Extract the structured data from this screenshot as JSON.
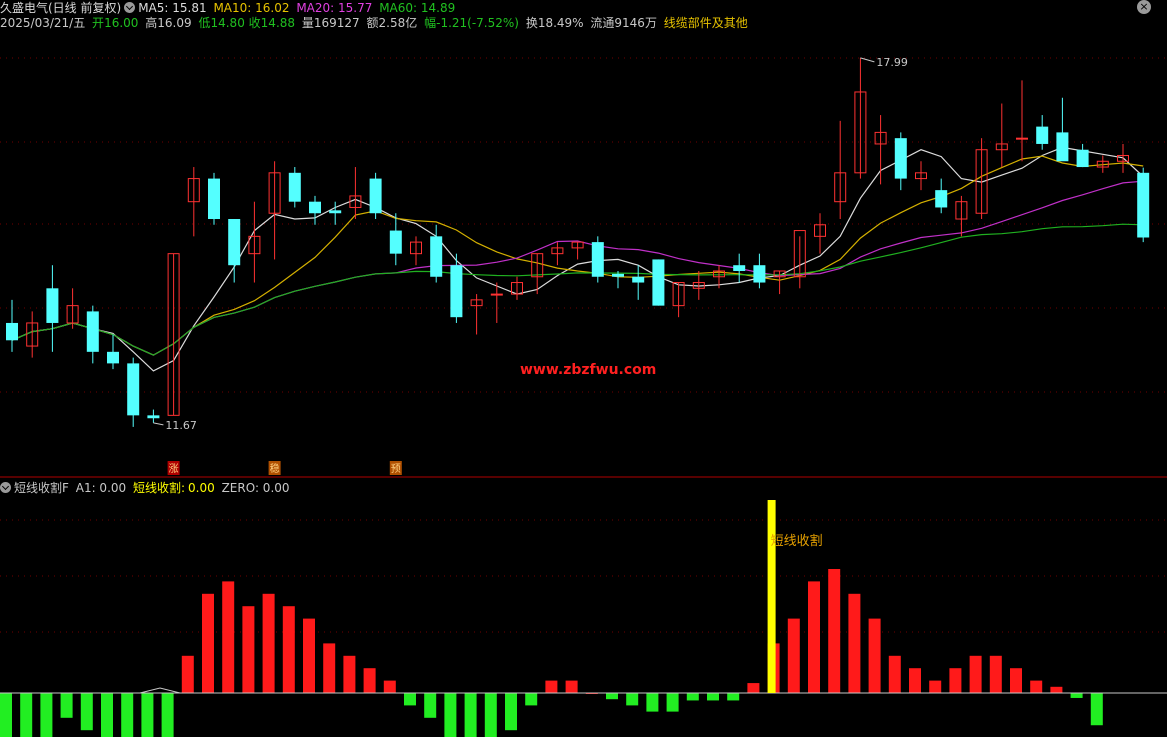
{
  "header": {
    "title": "久盛电气(日线 前复权)",
    "ma": [
      {
        "label": "MA5: 15.81",
        "color": "#dcdcdc"
      },
      {
        "label": "MA10: 16.02",
        "color": "#e6c200"
      },
      {
        "label": "MA20: 15.77",
        "color": "#e040e0"
      },
      {
        "label": "MA60: 14.89",
        "color": "#20c020"
      }
    ],
    "close_icon": "close-icon",
    "expand_icon": "chevron-down-icon"
  },
  "quote": {
    "date": "2025/03/21/五",
    "open_label": "开",
    "open": "16.00",
    "high_label": "高",
    "high": "16.09",
    "low_label": "低",
    "low": "14.80",
    "close_label": "收",
    "close": "14.88",
    "vol_label": "量",
    "vol": "169127",
    "amount_label": "额",
    "amount": "2.58亿",
    "change_label": "幅",
    "change": "-1.21(-7.52%)",
    "turnover": "换18.49%",
    "float": "流通9146万",
    "sector": "线缆部件及其他"
  },
  "price_labels": {
    "high_mark": "17.99",
    "low_mark": "11.67"
  },
  "signals": [
    "涨",
    "稳",
    "预"
  ],
  "watermark": "www.zbzfwu.com",
  "indicator": {
    "name": "短线收割F",
    "a1": "A1: 0.00",
    "cut_label": "短线收割:",
    "cut_value": "0.00",
    "zero": "ZERO: 0.00",
    "annotation": "短线收割"
  },
  "colors": {
    "up": "#ff3232",
    "down": "#54ffff",
    "bar_up": "#ff1a1a",
    "bar_down": "#22ee22",
    "signal": "#ffff00"
  },
  "chart_data": {
    "type": "candlestick",
    "price_range": [
      11.2,
      18.3
    ],
    "candles": [
      [
        13.4,
        13.8,
        12.9,
        13.1
      ],
      [
        13.0,
        13.6,
        12.8,
        13.4
      ],
      [
        14.0,
        14.4,
        12.9,
        13.4
      ],
      [
        13.4,
        14.0,
        13.3,
        13.7
      ],
      [
        13.6,
        13.7,
        12.7,
        12.9
      ],
      [
        12.9,
        13.2,
        12.6,
        12.7
      ],
      [
        12.7,
        12.8,
        11.6,
        11.8
      ],
      [
        11.8,
        11.9,
        11.67,
        11.75
      ],
      [
        11.8,
        14.6,
        11.8,
        14.6
      ],
      [
        15.5,
        16.1,
        14.9,
        15.9
      ],
      [
        15.9,
        16.0,
        15.1,
        15.2
      ],
      [
        15.2,
        15.2,
        14.1,
        14.4
      ],
      [
        14.6,
        15.5,
        14.1,
        14.9
      ],
      [
        15.3,
        16.2,
        14.5,
        16.0
      ],
      [
        16.0,
        16.1,
        15.4,
        15.5
      ],
      [
        15.5,
        15.6,
        15.1,
        15.3
      ],
      [
        15.35,
        15.5,
        15.1,
        15.3
      ],
      [
        15.4,
        16.1,
        15.2,
        15.6
      ],
      [
        15.9,
        16.0,
        15.2,
        15.3
      ],
      [
        15.0,
        15.3,
        14.4,
        14.6
      ],
      [
        14.6,
        14.9,
        14.4,
        14.8
      ],
      [
        14.9,
        15.1,
        14.1,
        14.2
      ],
      [
        14.4,
        14.6,
        13.4,
        13.5
      ],
      [
        13.7,
        13.9,
        13.2,
        13.8
      ],
      [
        13.9,
        14.1,
        13.4,
        13.9
      ],
      [
        13.9,
        14.2,
        13.8,
        14.1
      ],
      [
        14.2,
        14.6,
        13.9,
        14.6
      ],
      [
        14.6,
        14.8,
        14.4,
        14.7
      ],
      [
        14.7,
        14.8,
        14.5,
        14.8
      ],
      [
        14.8,
        14.9,
        14.1,
        14.2
      ],
      [
        14.25,
        14.3,
        14.0,
        14.2
      ],
      [
        14.2,
        14.4,
        13.8,
        14.1
      ],
      [
        14.5,
        14.5,
        13.7,
        13.7
      ],
      [
        13.7,
        14.1,
        13.5,
        14.1
      ],
      [
        14.0,
        14.3,
        13.8,
        14.1
      ],
      [
        14.2,
        14.4,
        14.0,
        14.3
      ],
      [
        14.4,
        14.6,
        14.1,
        14.3
      ],
      [
        14.4,
        14.6,
        14.0,
        14.1
      ],
      [
        14.2,
        14.3,
        13.9,
        14.3
      ],
      [
        14.2,
        14.9,
        14.0,
        15.0
      ],
      [
        14.9,
        15.3,
        14.6,
        15.1
      ],
      [
        15.5,
        16.9,
        15.2,
        16.0
      ],
      [
        16.0,
        17.99,
        15.9,
        17.4
      ],
      [
        16.5,
        17.0,
        15.8,
        16.7
      ],
      [
        16.6,
        16.7,
        15.7,
        15.9
      ],
      [
        15.9,
        16.2,
        15.7,
        16.0
      ],
      [
        15.7,
        15.9,
        15.3,
        15.4
      ],
      [
        15.2,
        15.6,
        14.9,
        15.5
      ],
      [
        15.3,
        16.6,
        15.2,
        16.4
      ],
      [
        16.4,
        17.2,
        16.1,
        16.5
      ],
      [
        16.6,
        17.6,
        16.2,
        16.6
      ],
      [
        16.8,
        17.0,
        16.4,
        16.5
      ],
      [
        16.7,
        17.3,
        16.4,
        16.2
      ],
      [
        16.4,
        16.5,
        16.1,
        16.1
      ],
      [
        16.1,
        16.3,
        16.0,
        16.2
      ],
      [
        16.2,
        16.5,
        16.0,
        16.3
      ],
      [
        16.0,
        16.09,
        14.8,
        14.88
      ]
    ],
    "ma5": "white",
    "ma10": "gold",
    "ma20": "magenta",
    "ma60": "green",
    "indicator_bars": [
      -4,
      -4,
      -4,
      -2,
      -3,
      -4,
      -4,
      -4,
      -4,
      3,
      8,
      9,
      7,
      8,
      7,
      6,
      4,
      3,
      2,
      1,
      -1,
      -2,
      -4,
      -4,
      -4,
      -3,
      -1,
      1,
      1,
      0,
      -0.5,
      -1,
      -1.5,
      -1.5,
      -0.6,
      -0.6,
      -0.6,
      0.8,
      4,
      6,
      9,
      10,
      8,
      6,
      3,
      2,
      1,
      2,
      3,
      3,
      2,
      1,
      0.5,
      -0.4,
      -2.6
    ],
    "signal_index": 38
  }
}
